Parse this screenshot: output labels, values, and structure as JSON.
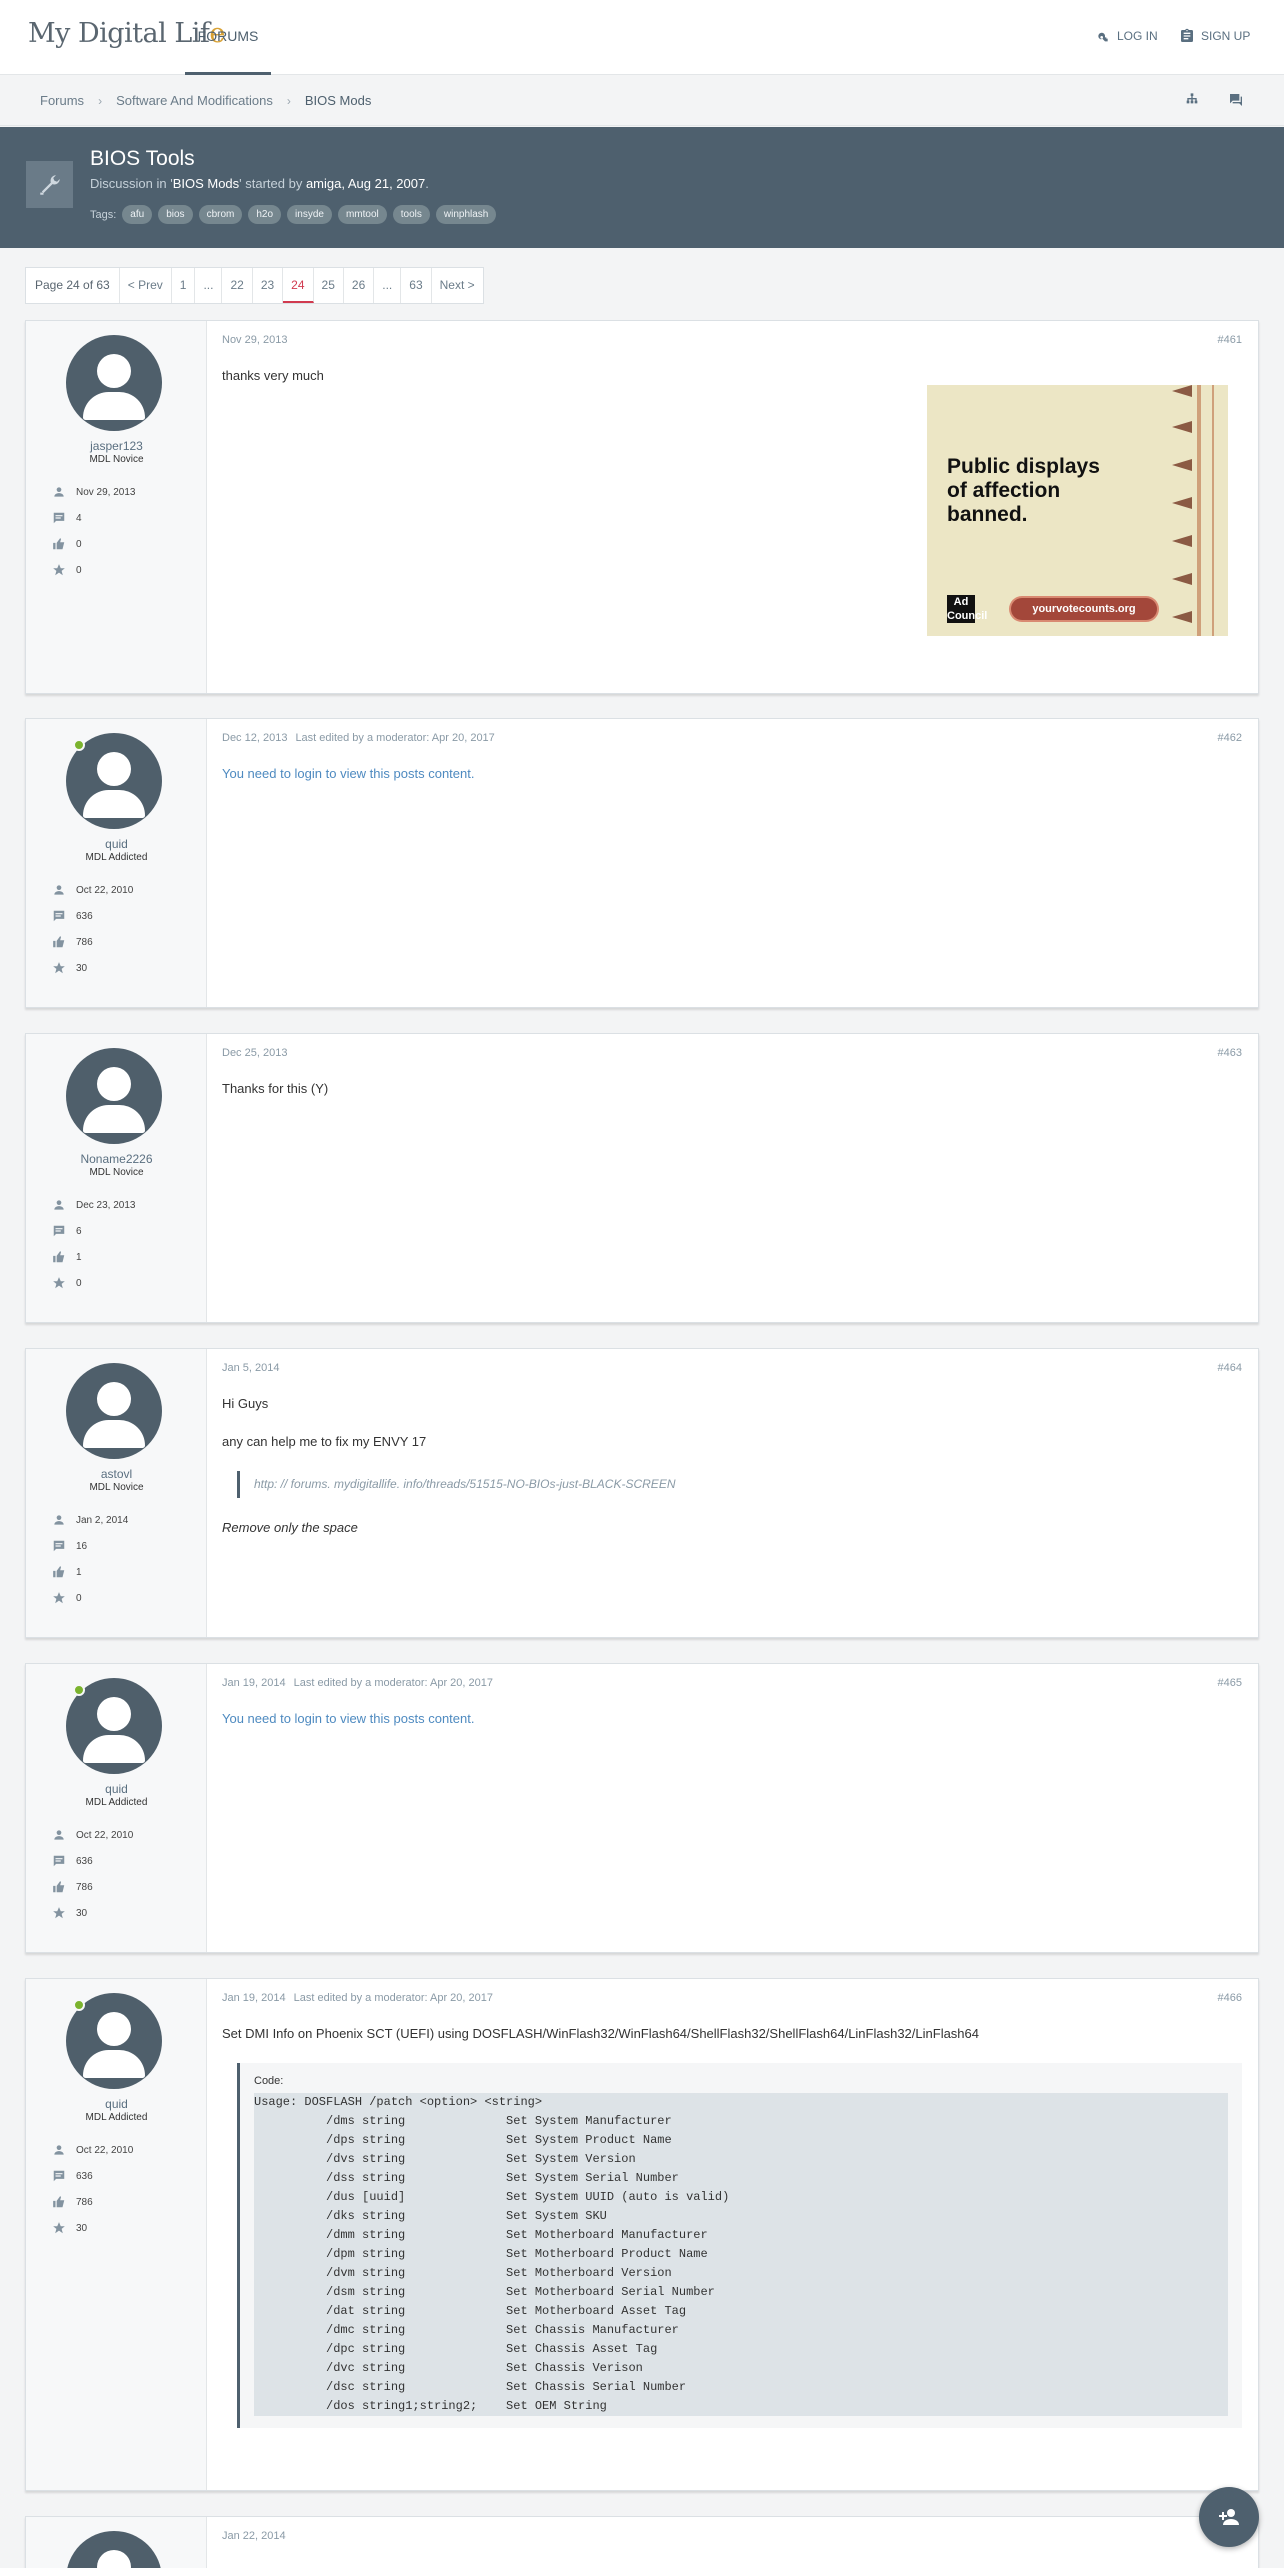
{
  "header": {
    "logo_main": "My Digital Lif",
    "logo_accent": "e",
    "nav_forums": "FORUMS",
    "login": "LOG IN",
    "signup": "SIGN UP"
  },
  "breadcrumbs": [
    "Forums",
    "Software And Modifications",
    "BIOS Mods"
  ],
  "thread": {
    "title": "BIOS Tools",
    "desc_prefix": "Discussion in '",
    "forum": "BIOS Mods",
    "desc_mid": "' started by ",
    "author": "amiga",
    "date": ", Aug 21, 2007",
    "desc_suffix": ".",
    "tags_label": "Tags:",
    "tags": [
      "afu",
      "bios",
      "cbrom",
      "h2o",
      "insyde",
      "mmtool",
      "tools",
      "winphlash"
    ]
  },
  "pagination": {
    "label": "Page 24 of 63",
    "prev": "< Prev",
    "next": "Next >",
    "pages": [
      "1",
      "...",
      "22",
      "23",
      "24",
      "25",
      "26",
      "...",
      "63"
    ],
    "current": "24"
  },
  "posts": [
    {
      "username": "jasper123",
      "role": "MDL Novice",
      "online": false,
      "joined": "Nov 29, 2013",
      "messages": "4",
      "likes": "0",
      "points": "0",
      "date": "Nov 29, 2013",
      "edited": "",
      "number": "#461",
      "lines": [
        "thanks very much"
      ]
    },
    {
      "username": "quid",
      "role": "MDL Addicted",
      "online": true,
      "joined": "Oct 22, 2010",
      "messages": "636",
      "likes": "786",
      "points": "30",
      "date": "Dec 12, 2013",
      "edited": "Last edited by a moderator: Apr 20, 2017",
      "number": "#462",
      "lines": [
        "You need to login to view this posts content."
      ]
    },
    {
      "username": "Noname2226",
      "role": "MDL Novice",
      "online": false,
      "joined": "Dec 23, 2013",
      "messages": "6",
      "likes": "1",
      "points": "0",
      "date": "Dec 25, 2013",
      "edited": "",
      "number": "#463",
      "lines": [
        "Thanks for this (Y)"
      ]
    },
    {
      "username": "astovl",
      "role": "MDL Novice",
      "online": false,
      "joined": "Jan 2, 2014",
      "messages": "16",
      "likes": "1",
      "points": "0",
      "date": "Jan 5, 2014",
      "edited": "",
      "number": "#464",
      "lines": [
        "Hi Guys",
        "any can help me to fix my ENVY 17"
      ],
      "quote": "http: // forums. mydigitallife. info/threads/51515-NO-BIOs-just-BLACK-SCREEN",
      "after_quote": "Remove only the space"
    },
    {
      "username": "quid",
      "role": "MDL Addicted",
      "online": true,
      "joined": "Oct 22, 2010",
      "messages": "636",
      "likes": "786",
      "points": "30",
      "date": "Jan 19, 2014",
      "edited": "Last edited by a moderator: Apr 20, 2017",
      "number": "#465",
      "lines": [
        "You need to login to view this posts content."
      ]
    },
    {
      "username": "quid",
      "role": "MDL Addicted",
      "online": true,
      "joined": "Oct 22, 2010",
      "messages": "636",
      "likes": "786",
      "points": "30",
      "date": "Jan 19, 2014",
      "edited": "Last edited by a moderator: Apr 20, 2017",
      "number": "#466",
      "lines": [
        "Set DMI Info on Phoenix SCT (UEFI) using DOSFLASH/WinFlash32/WinFlash64/ShellFlash32/ShellFlash64/LinFlash32/LinFlash64"
      ],
      "code_label": "Code:",
      "code": [
        "Usage: DOSFLASH /patch <option> <string>",
        "",
        "          /dms string              Set System Manufacturer",
        "          /dps string              Set System Product Name",
        "          /dvs string              Set System Version",
        "          /dss string              Set System Serial Number",
        "          /dus [uuid]              Set System UUID (auto is valid)",
        "          /dks string              Set System SKU",
        "          /dmm string              Set Motherboard Manufacturer",
        "          /dpm string              Set Motherboard Product Name",
        "          /dvm string              Set Motherboard Version",
        "          /dsm string              Set Motherboard Serial Number",
        "          /dat string              Set Motherboard Asset Tag",
        "          /dmc string              Set Chassis Manufacturer",
        "          /dpc string              Set Chassis Asset Tag",
        "          /dvc string              Set Chassis Verison",
        "          /dsc string              Set Chassis Serial Number",
        "          /dos string1;string2;    Set OEM String"
      ]
    },
    {
      "username": "",
      "role": "",
      "online": false,
      "joined": "",
      "messages": "",
      "likes": "",
      "points": "",
      "date": "Jan 22, 2014",
      "edited": "",
      "number": "",
      "lines": []
    }
  ],
  "ad": {
    "headline": [
      "Public displays",
      "of affection",
      "banned."
    ],
    "badge": "Ad Council",
    "url": "yourvotecounts.org"
  },
  "colors": {
    "header_banner": "#4e606e",
    "accent_red": "#d13a4f",
    "link_blue": "#4e8ac0",
    "online_green": "#7bb32e"
  },
  "icons": {
    "login": "key-icon",
    "signup": "clipboard-icon",
    "sitemap": "sitemap-icon",
    "chat": "chat-icon",
    "thread": "wrench-icon",
    "joined": "user-icon",
    "messages": "message-icon",
    "likes": "thumbs-up-icon",
    "points": "star-icon",
    "fab": "add-user-icon"
  }
}
